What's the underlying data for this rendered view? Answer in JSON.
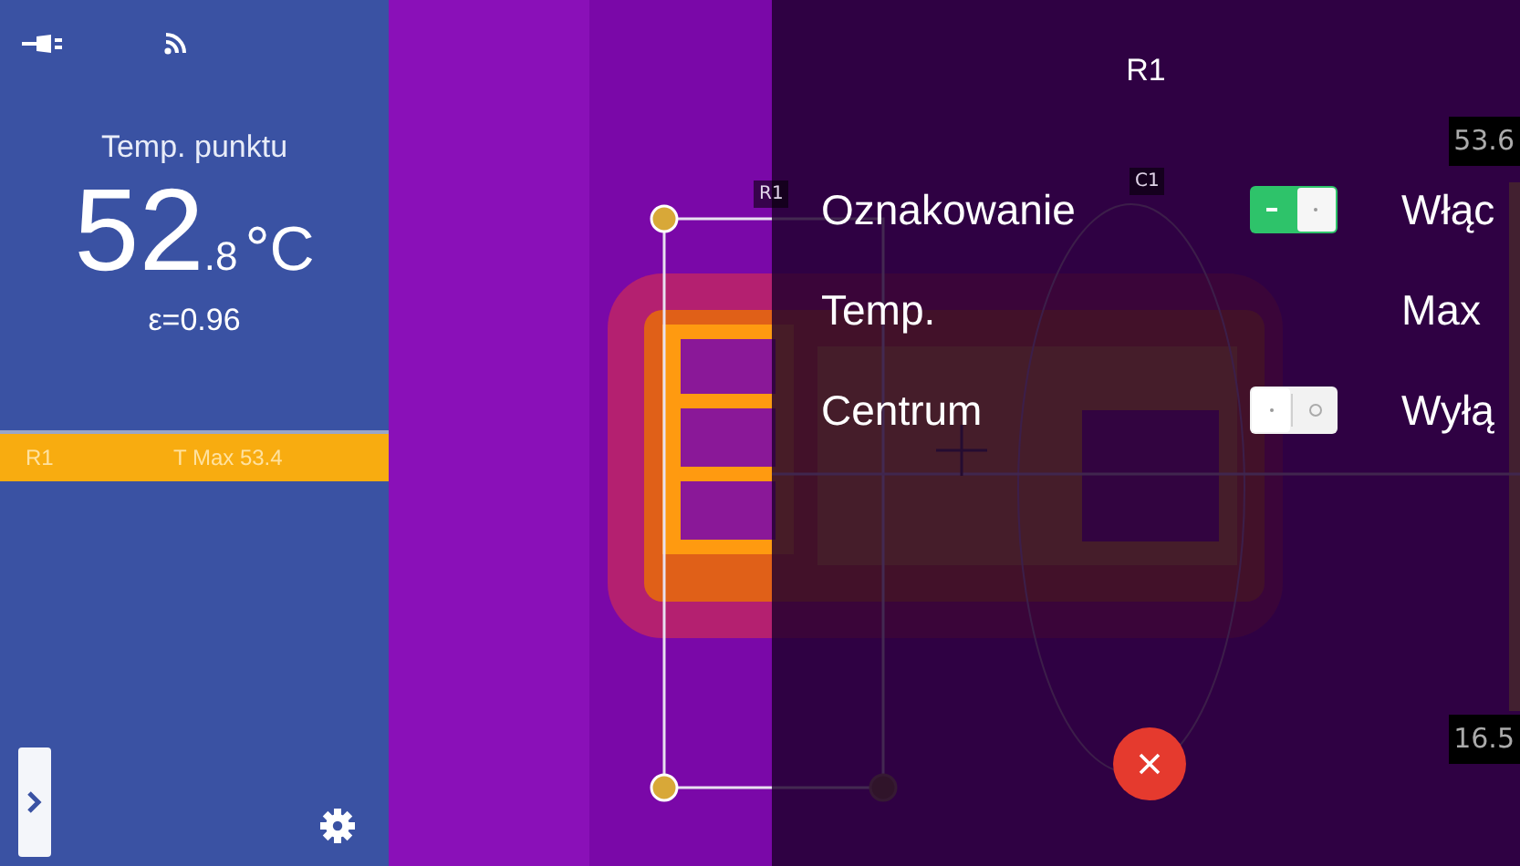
{
  "sidebar": {
    "label": "Temp. punktu",
    "value_whole": "52",
    "value_fraction": ".8",
    "unit": "°C",
    "emissivity": "ε=0.96",
    "measurements": [
      {
        "name": "R1",
        "reading": "T Max 53.4",
        "selected": true
      }
    ]
  },
  "image": {
    "kind": "picture",
    "markers": [
      {
        "kind": "rectangle",
        "label": "R1"
      },
      {
        "kind": "ellipse",
        "label": "C1"
      }
    ],
    "scale": {
      "max": "53.6",
      "min": "16.5"
    }
  },
  "panel": {
    "title": "R1",
    "settings": [
      {
        "kind": "toggle",
        "label": "Oznakowanie",
        "on": true,
        "value": "Włąc"
      },
      {
        "kind": "value",
        "label": "Temp.",
        "value": "Max"
      },
      {
        "kind": "toggle",
        "label": "Centrum",
        "on": false,
        "value": "Wyłą"
      }
    ]
  }
}
